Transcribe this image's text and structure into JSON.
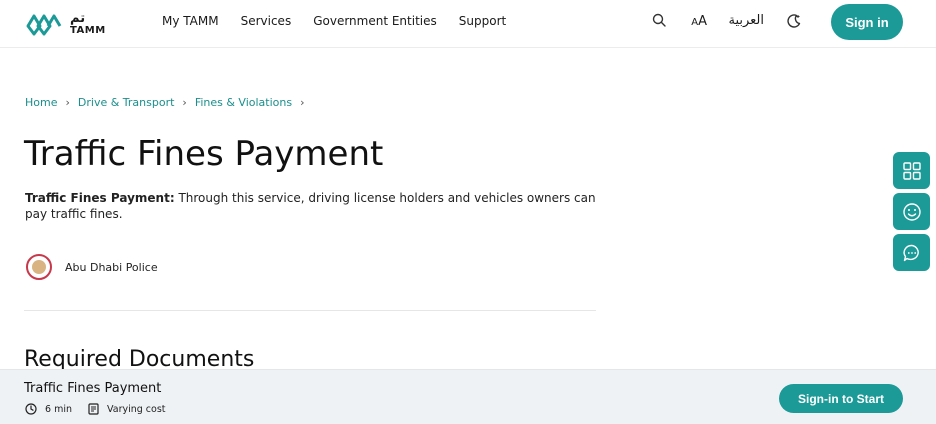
{
  "header": {
    "logo": {
      "arabic": "تم",
      "english": "TAMM"
    },
    "nav": [
      "My TAMM",
      "Services",
      "Government Entities",
      "Support"
    ],
    "font_size_label_small": "A",
    "font_size_label_large": "A",
    "language_label": "العربية",
    "signin_label": "Sign in"
  },
  "breadcrumb": {
    "items": [
      "Home",
      "Drive & Transport",
      "Fines & Violations"
    ]
  },
  "page": {
    "title": "Traffic Fines Payment",
    "description_bold": "Traffic Fines Payment:",
    "description_rest": " Through this service, driving license holders and vehicles owners can pay traffic fines.",
    "entity_name": "Abu Dhabi Police",
    "section_heading": "Required Documents"
  },
  "bottom_bar": {
    "title": "Traffic Fines Payment",
    "duration": "6 min",
    "cost": "Varying cost",
    "start_label": "Sign-in to Start"
  },
  "colors": {
    "accent": "#1b9a97",
    "breadcrumb": "#1b8f8c",
    "bottom_bar_bg": "#eef2f5"
  }
}
